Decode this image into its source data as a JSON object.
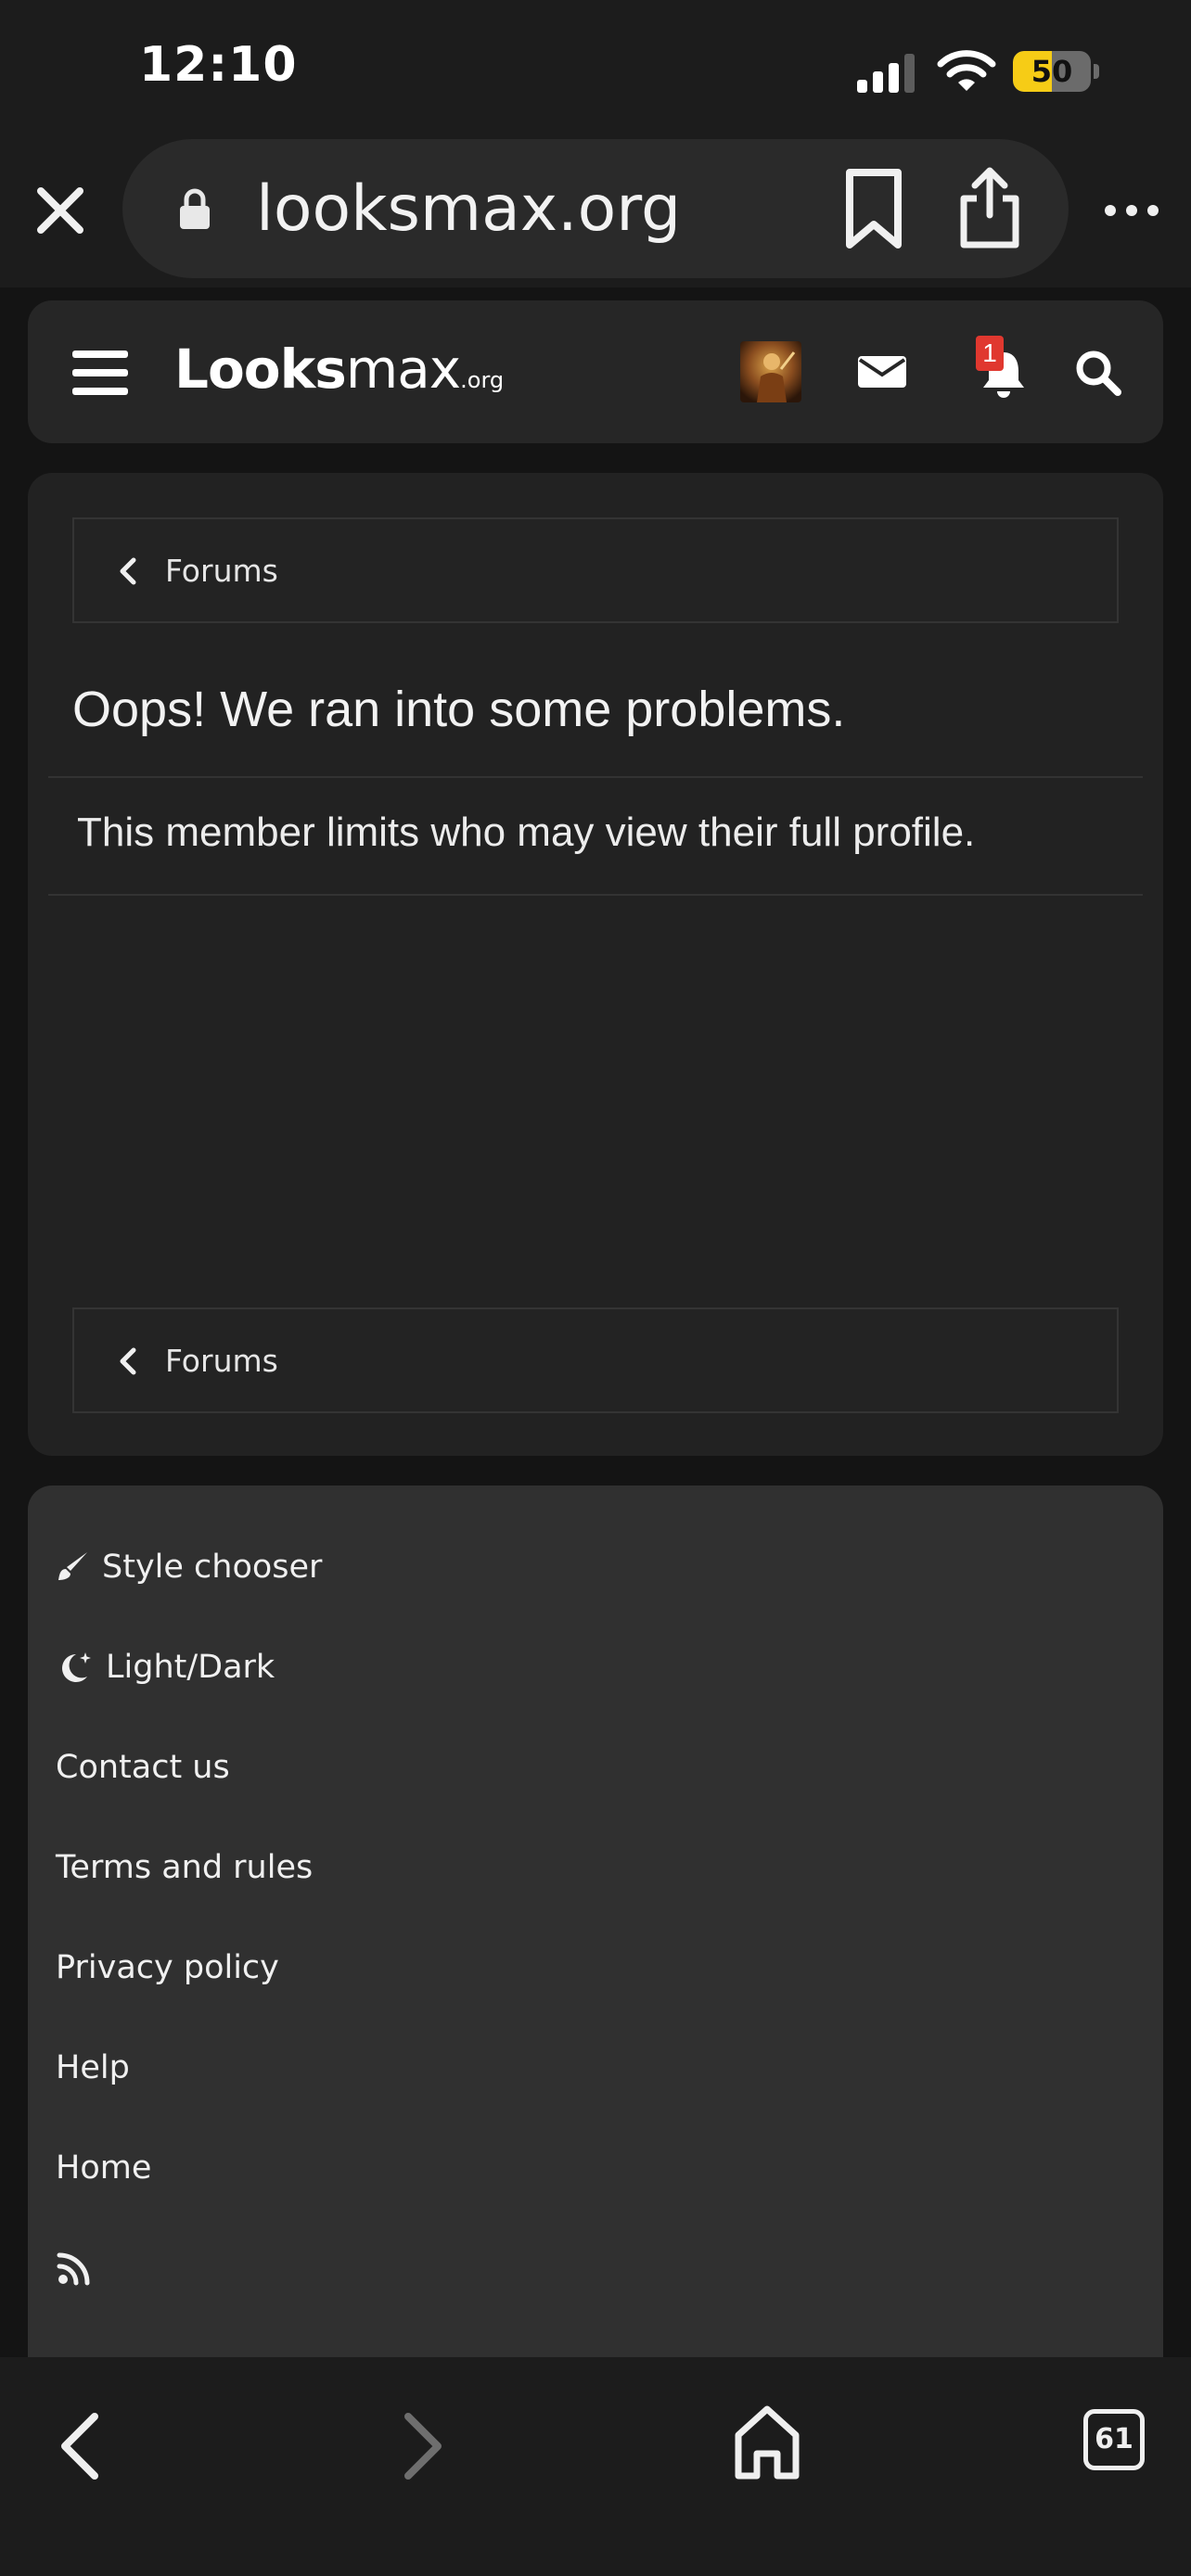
{
  "status_bar": {
    "time": "12:10",
    "battery_percent": "50",
    "battery_level": 0.5,
    "signal_bars_active": 3,
    "signal_bars_total": 4,
    "battery_color": "#f6cc16"
  },
  "browser": {
    "url": "looksmax.org",
    "close_icon": "close-icon",
    "lock_icon": "lock-icon",
    "bookmark_icon": "bookmark-icon",
    "share_icon": "share-icon",
    "more_icon": "more-icon"
  },
  "site_header": {
    "logo_prefix": "Looks",
    "logo_max": "max",
    "logo_suffix": ".org",
    "notification_count": "1",
    "notification_badge_color": "#e0382f",
    "icons": [
      "hamburger-icon",
      "avatar",
      "mail-icon",
      "bell-icon",
      "search-icon"
    ]
  },
  "content": {
    "breadcrumb_top": "Forums",
    "error_title": "Oops! We ran into some problems.",
    "error_message": "This member limits who may view their full profile.",
    "breadcrumb_bottom": "Forums"
  },
  "footer": {
    "items": [
      {
        "label": "Style chooser",
        "icon": "paintbrush-icon"
      },
      {
        "label": "Light/Dark",
        "icon": "moon-icon"
      },
      {
        "label": "Contact us"
      },
      {
        "label": "Terms and rules"
      },
      {
        "label": "Privacy policy"
      },
      {
        "label": "Help"
      },
      {
        "label": "Home"
      },
      {
        "label": "",
        "icon": "rss-icon"
      }
    ]
  },
  "bottom_bar": {
    "tab_count": "61",
    "icons": [
      "back-icon",
      "forward-icon",
      "home-icon",
      "tabs-icon"
    ]
  }
}
